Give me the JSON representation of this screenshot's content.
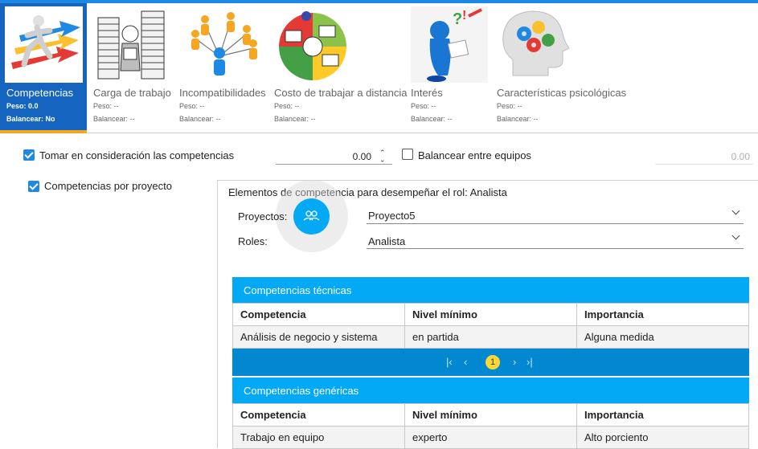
{
  "tabs": [
    {
      "name": "Competencias",
      "weight": "Peso: 0.0",
      "balance": "Balancear: No",
      "icon": "running-man-arrows-icon"
    },
    {
      "name": "Carga de trabajo",
      "weight": "Peso: --",
      "balance": "Balancear: --",
      "icon": "stressed-paper-stack-icon"
    },
    {
      "name": "Incompatibilidades",
      "weight": "Peso: --",
      "balance": "Balancear: --",
      "icon": "people-network-icon"
    },
    {
      "name": "Costo de trabajar a distancia",
      "weight": "Peso: --",
      "balance": "Balancear: --",
      "icon": "remote-work-pie-icon"
    },
    {
      "name": "Interés",
      "weight": "Peso: --",
      "balance": "Balancear: --",
      "icon": "question-figure-icon"
    },
    {
      "name": "Características psicológicas",
      "weight": "Peso: --",
      "balance": "Balancear: --",
      "icon": "head-gears-icon"
    }
  ],
  "options": {
    "consider_label": "Tomar en consideración las competencias",
    "consider_checked": true,
    "consider_value": "0.00",
    "balance_label": "Balancear entre equipos",
    "balance_checked": false,
    "balance_value": "0.00",
    "per_project_label": "Competencias por proyecto",
    "per_project_checked": true
  },
  "panel": {
    "title": "Elementos de competencia para desempeñar el rol: Analista",
    "projects_label": "Proyectos:",
    "projects_value": "Proyecto5",
    "roles_label": "Roles:",
    "roles_value": "Analista"
  },
  "technical": {
    "title": "Competencias técnicas",
    "columns": [
      "Competencia",
      "Nivel mínimo",
      "Importancia"
    ],
    "rows": [
      [
        "Análisis de negocio y sistema",
        "en partida",
        "Alguna medida"
      ]
    ],
    "page": "1"
  },
  "generic": {
    "title": "Competencias genéricas",
    "columns": [
      "Competencia",
      "Nivel mínimo",
      "Importancia"
    ],
    "rows": [
      [
        "Trabajo en equipo",
        "experto",
        "Alto porciento"
      ]
    ]
  },
  "colors": {
    "accent": "#03a9f4",
    "active_tab": "#1565c0",
    "pager": "#0288d1",
    "page_badge": "#fdd835"
  }
}
